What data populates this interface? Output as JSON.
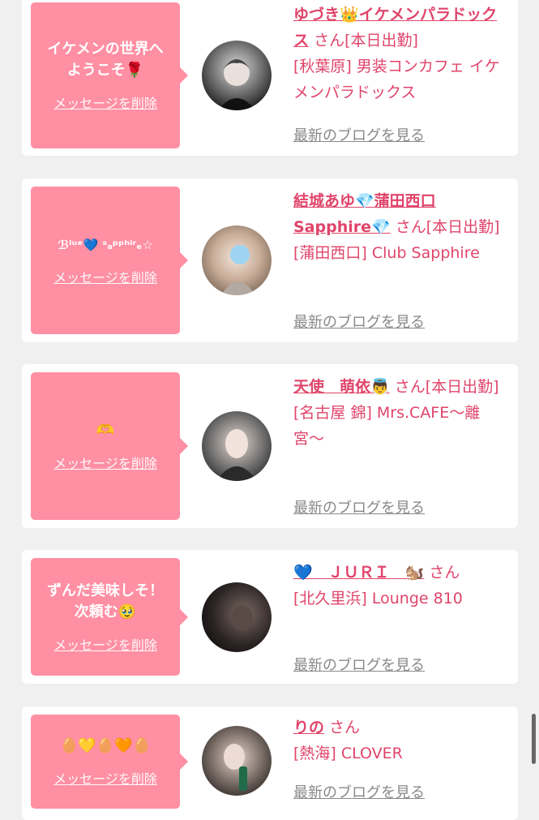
{
  "cards": [
    {
      "message": "イケメンの世界へ\nようこそ🌹",
      "delete_label": "メッセージを削除",
      "name": "ゆづき👑イケメンパラドックス",
      "san": "さん[本日出勤]",
      "shop": "[秋葉原] 男装コンカフェ イケメンパラドックス",
      "blog_label": "最新のブログを見る",
      "avatar_icon": "avatar-photo"
    },
    {
      "message": "ℬˡᵘᵉ💙 ˢₐᵖᵖʰⁱʳₑ☆",
      "delete_label": "メッセージを削除",
      "name": "結城あゆ💎蒲田西口Sapphire💎",
      "san": "さん[本日出勤]",
      "shop": "[蒲田西口] Club Sapphire",
      "blog_label": "最新のブログを見る",
      "avatar_icon": "avatar-photo"
    },
    {
      "message": "🫶",
      "delete_label": "メッセージを削除",
      "name": "天使　萌依👼",
      "san": "さん[本日出勤]",
      "shop": "[名古屋 錦] Mrs.CAFE〜離宮〜",
      "blog_label": "最新のブログを見る",
      "avatar_icon": "avatar-photo"
    },
    {
      "message": "ずんだ美味しそ！\n次頼む🥹",
      "delete_label": "メッセージを削除",
      "name": "💙　ＪＵＲＩ　🐿️",
      "san": "さん",
      "shop": "[北久里浜] Lounge 810",
      "blog_label": "最新のブログを見る",
      "avatar_icon": "avatar-photo"
    },
    {
      "message": "🥚💛🥚🧡🥚",
      "delete_label": "メッセージを削除",
      "name": "りの",
      "san": "さん",
      "shop": "[熱海] CLOVER",
      "blog_label": "最新のブログを見る",
      "avatar_icon": "avatar-photo"
    }
  ],
  "colors": {
    "accent": "#e0446a",
    "bubble": "#ff8fa3",
    "background": "#f0f0f0"
  }
}
